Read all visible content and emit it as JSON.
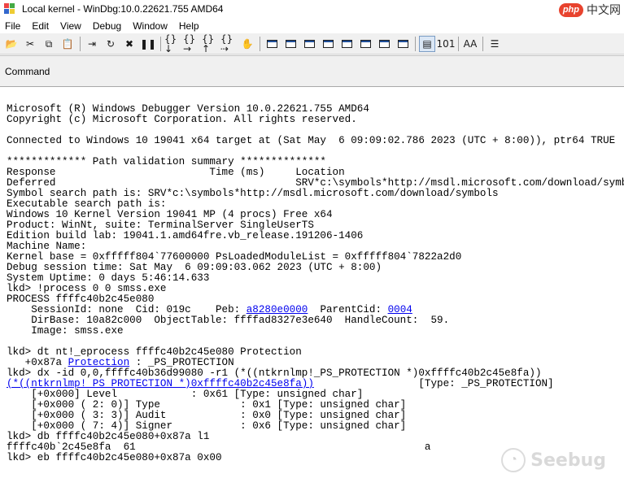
{
  "window": {
    "title": "Local kernel - WinDbg:10.0.22621.755 AMD64"
  },
  "watermark": {
    "php_badge": "php",
    "php_cn": "中文网",
    "seebug": "Seebug"
  },
  "menu": [
    "File",
    "Edit",
    "View",
    "Debug",
    "Window",
    "Help"
  ],
  "toolbar": [
    {
      "name": "open-icon",
      "glyph": "📂"
    },
    {
      "name": "cut-icon",
      "glyph": "✂"
    },
    {
      "name": "copy-icon",
      "glyph": "⧉"
    },
    {
      "name": "paste-icon",
      "glyph": "📋"
    },
    {
      "name": "go-icon",
      "glyph": "⇥"
    },
    {
      "name": "restart-icon",
      "glyph": "↻"
    },
    {
      "name": "stop-debugging-icon",
      "glyph": "✖"
    },
    {
      "name": "break-icon",
      "glyph": "❚❚"
    },
    {
      "name": "step-into-icon",
      "glyph": "{}↓"
    },
    {
      "name": "step-over-icon",
      "glyph": "{}→"
    },
    {
      "name": "step-out-icon",
      "glyph": "{}↑"
    },
    {
      "name": "run-to-cursor-icon",
      "glyph": "{}⇢"
    },
    {
      "name": "breakpoint-hand-icon",
      "glyph": "✋"
    },
    {
      "name": "command-window-icon",
      "box": true
    },
    {
      "name": "watch-window-icon",
      "box": true
    },
    {
      "name": "locals-window-icon",
      "box": true
    },
    {
      "name": "registers-window-icon",
      "box": true
    },
    {
      "name": "memory-window-icon",
      "box": true
    },
    {
      "name": "call-stack-window-icon",
      "box": true
    },
    {
      "name": "disassembly-window-icon",
      "box": true
    },
    {
      "name": "scratch-pad-icon",
      "box": true
    },
    {
      "name": "source-mode-icon",
      "glyph": "▤",
      "active": true
    },
    {
      "name": "hex-mode-icon",
      "glyph": "101"
    },
    {
      "name": "font-icon",
      "glyph": "AA"
    },
    {
      "name": "options-icon",
      "glyph": "☰"
    }
  ],
  "pane": {
    "title": "Command"
  },
  "console": {
    "lines": [
      "",
      "Microsoft (R) Windows Debugger Version 10.0.22621.755 AMD64",
      "Copyright (c) Microsoft Corporation. All rights reserved.",
      "",
      "Connected to Windows 10 19041 x64 target at (Sat May  6 09:09:02.786 2023 (UTC + 8:00)), ptr64 TRUE",
      "",
      "************* Path validation summary **************",
      "Response                         Time (ms)     Location",
      "Deferred                                       SRV*c:\\symbols*http://msdl.microsoft.com/download/symbols",
      "Symbol search path is: SRV*c:\\symbols*http://msdl.microsoft.com/download/symbols",
      "Executable search path is:",
      "Windows 10 Kernel Version 19041 MP (4 procs) Free x64",
      "Product: WinNt, suite: TerminalServer SingleUserTS",
      "Edition build lab: 19041.1.amd64fre.vb_release.191206-1406",
      "Machine Name:",
      "Kernel base = 0xfffff804`77600000 PsLoadedModuleList = 0xfffff804`7822a2d0",
      "Debug session time: Sat May  6 09:09:03.062 2023 (UTC + 8:00)",
      "System Uptime: 0 days 5:46:14.633",
      "lkd> !process 0 0 smss.exe",
      "PROCESS ffffc40b2c45e080",
      [
        {
          "t": "    SessionId: none  Cid: 019c    Peb: "
        },
        {
          "t": "a8280e0000",
          "link": true
        },
        {
          "t": "  ParentCid: "
        },
        {
          "t": "0004",
          "link": true
        }
      ],
      "    DirBase: 10a82c000  ObjectTable: ffffad8327e3e640  HandleCount:  59.",
      "    Image: smss.exe",
      "",
      "lkd> dt nt!_eprocess ffffc40b2c45e080 Protection",
      [
        {
          "t": "   +0x87a "
        },
        {
          "t": "Protection",
          "link": true
        },
        {
          "t": " : _PS_PROTECTION"
        }
      ],
      "lkd> dx -id 0,0,ffffc40b36d99080 -r1 (*((ntkrnlmp!_PS_PROTECTION *)0xffffc40b2c45e8fa))",
      [
        {
          "t": "(*((ntkrnlmp!_PS_PROTECTION *)0xffffc40b2c45e8fa))",
          "link": true
        },
        {
          "t": "                 [Type: _PS_PROTECTION]"
        }
      ],
      "    [+0x000] Level            : 0x61 [Type: unsigned char]",
      "    [+0x000 ( 2: 0)] Type             : 0x1 [Type: unsigned char]",
      "    [+0x000 ( 3: 3)] Audit            : 0x0 [Type: unsigned char]",
      "    [+0x000 ( 7: 4)] Signer           : 0x6 [Type: unsigned char]",
      "lkd> db ffffc40b2c45e080+0x87a l1",
      "ffffc40b`2c45e8fa  61                                               a",
      "lkd> eb ffffc40b2c45e080+0x87a 0x00"
    ]
  }
}
